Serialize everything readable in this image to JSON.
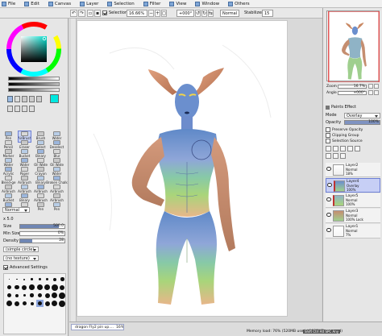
{
  "menubar": {
    "items": [
      "File",
      "Edit",
      "Canvas",
      "Layer",
      "Selection",
      "Filter",
      "View",
      "Window",
      "Others"
    ]
  },
  "toolbar": {
    "selection_label": "Selection",
    "zoom": "16.66%",
    "angle": "+000°",
    "blend": "Normal",
    "stabilizer_label": "Stabilizer",
    "stabilizer": "15"
  },
  "navigator": {
    "zoom_label": "Zoom",
    "zoom": "16.7%",
    "angle_label": "Angle",
    "angle": "+000°"
  },
  "paints_effect": {
    "title": "Paints Effect"
  },
  "layer_panel": {
    "mode_label": "Mode",
    "mode": "Overlay",
    "opacity_label": "Opacity",
    "opacity": "100%",
    "preserve_opacity": "Preserve Opacity",
    "clipping_group": "Clipping Group",
    "selection_source": "Selection Source",
    "layers": [
      {
        "name": "Layer2",
        "mode": "Normal",
        "opacity": "18%",
        "active": false,
        "clip": false
      },
      {
        "name": "Layer4",
        "mode": "Overlay",
        "opacity": "100%",
        "active": true,
        "clip": true
      },
      {
        "name": "Layer5",
        "mode": "Normal",
        "opacity": "100%",
        "active": false,
        "clip": true
      },
      {
        "name": "Layer3",
        "mode": "Normal",
        "opacity": "100% Lock",
        "active": false,
        "clip": false
      },
      {
        "name": "Layer1",
        "mode": "Normal",
        "opacity": "7%",
        "active": false,
        "clip": false
      }
    ]
  },
  "color": {
    "current_fg": "#00e8e0",
    "current_bg": "#ffffff"
  },
  "tools": {
    "row1": [
      "Pen",
      "AirBrush",
      "Brush",
      "Water"
    ],
    "row2": [
      "Pencil",
      "Eraser",
      "Select",
      "Deselect"
    ],
    "row3": [
      "Marker",
      "Bucket",
      "Binary",
      "Blur"
    ],
    "row4": [
      "Water",
      "Water",
      "Oil Wate",
      "Oil Wate"
    ],
    "row5": [
      "Acrylic",
      "Paper",
      "Crayon",
      "Water"
    ],
    "row6": [
      "Blend-ge",
      "Airbrush",
      "Binary",
      "Broken Chalk"
    ],
    "row7": [
      "Airbrush",
      "Airbrush",
      "Airbrush",
      "Airbrush"
    ],
    "row8": [
      "Bucket",
      "Binary",
      "Airbrush",
      "Airbrush"
    ],
    "row9": [
      "Pen",
      "Pen",
      "Pen",
      "Pen"
    ]
  },
  "brush_settings": {
    "size_multiplier": "x 5.0",
    "size_label": "Size",
    "size": "500.0",
    "minsize_label": "Min Size",
    "minsize": "0%",
    "density_label": "Density",
    "density": "28",
    "shape": "(simple circle)",
    "texture": "(no texture)",
    "advanced": "Advanced Settings",
    "blend_mode": "Normal"
  },
  "statusbar": {
    "tab_name": "dragon Fly2 pin up....",
    "tab_zoom": "16%",
    "memory": "Memory load: 76% (520MB used / 1022MB reserved)",
    "keys": "Shift Ctrl Alt SPC Any"
  }
}
